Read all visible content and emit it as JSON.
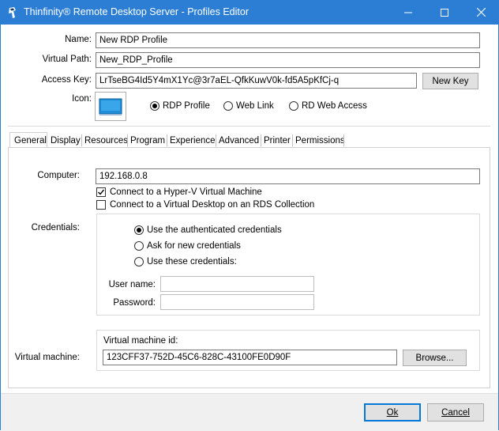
{
  "window": {
    "title": "Thinfinity® Remote Desktop Server - Profiles Editor",
    "minimize_icon": "minimize-icon",
    "maximize_icon": "maximize-icon",
    "close_icon": "close-icon"
  },
  "header": {
    "name_label": "Name:",
    "name_value": "New RDP Profile",
    "virtual_path_label": "Virtual Path:",
    "virtual_path_value": "New_RDP_Profile",
    "access_key_label": "Access Key:",
    "access_key_value": "LrTseBG4Id5Y4mX1Yc@3r7aEL-QfkKuwV0k-fd5A5pKfCj-q",
    "new_key_button": "New Key",
    "icon_label": "Icon:",
    "profile_types": [
      {
        "label": "RDP Profile",
        "selected": true
      },
      {
        "label": "Web Link",
        "selected": false
      },
      {
        "label": "RD Web Access",
        "selected": false
      }
    ]
  },
  "tabs": [
    "General",
    "Display",
    "Resources",
    "Program",
    "Experience",
    "Advanced",
    "Printer",
    "Permissions"
  ],
  "active_tab": "General",
  "general": {
    "computer_label": "Computer:",
    "computer_value": "192.168.0.8",
    "hyperv_checkbox": {
      "label": "Connect to a Hyper-V Virtual Machine",
      "checked": true
    },
    "rds_checkbox": {
      "label": "Connect to a Virtual Desktop on an RDS Collection",
      "checked": false
    },
    "credentials_label": "Credentials:",
    "credential_options": [
      {
        "label": "Use the authenticated credentials",
        "selected": true
      },
      {
        "label": "Ask for new credentials",
        "selected": false
      },
      {
        "label": "Use these credentials:",
        "selected": false
      }
    ],
    "username_label": "User name:",
    "username_value": "",
    "password_label": "Password:",
    "password_value": "",
    "virtual_machine_label": "Virtual machine:",
    "vm_id_label": "Virtual machine id:",
    "vm_id_value": "123CFF37-752D-45C6-828C-43100FE0D90F",
    "browse_button": "Browse..."
  },
  "footer": {
    "ok_button": "Ok",
    "cancel_button": "Cancel"
  },
  "colors": {
    "titlebar": "#2b7ed4",
    "icon_blue": "#1e8fd6"
  }
}
